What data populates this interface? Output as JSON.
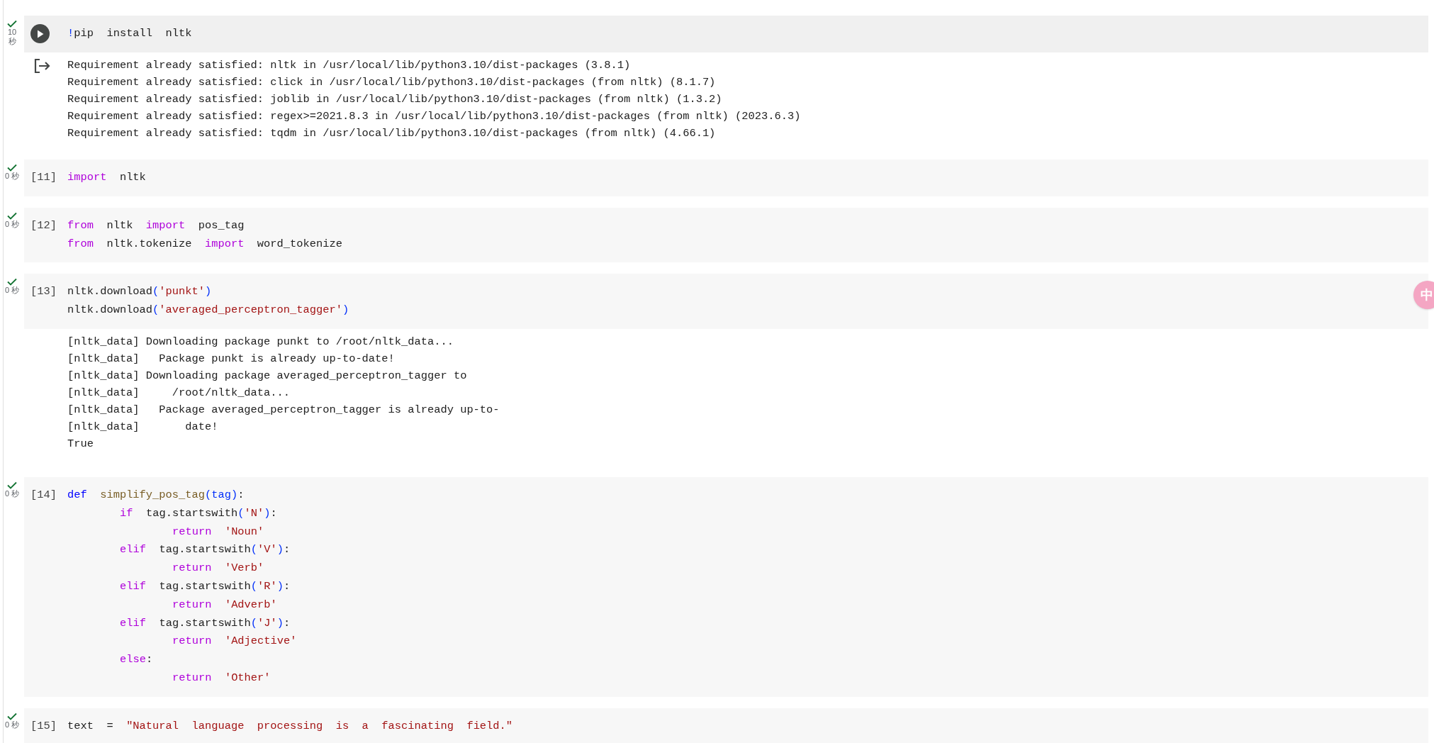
{
  "cells": [
    {
      "focused": true,
      "succeeded": true,
      "duration": "10 秒",
      "lines": [
        {
          "tokens": [
            {
              "kind": "paren",
              "text": "!"
            },
            {
              "kind": "plain",
              "text": "pip  install  nltk"
            }
          ]
        }
      ],
      "output": [
        "Requirement already satisfied: nltk in /usr/local/lib/python3.10/dist-packages (3.8.1)",
        "Requirement already satisfied: click in /usr/local/lib/python3.10/dist-packages (from nltk) (8.1.7)",
        "Requirement already satisfied: joblib in /usr/local/lib/python3.10/dist-packages (from nltk) (1.3.2)",
        "Requirement already satisfied: regex>=2021.8.3 in /usr/local/lib/python3.10/dist-packages (from nltk) (2023.6.3)",
        "Requirement already satisfied: tqdm in /usr/local/lib/python3.10/dist-packages (from nltk) (4.66.1)"
      ]
    },
    {
      "focused": false,
      "succeeded": true,
      "count": "[11]",
      "duration": "0 秒",
      "lines": [
        {
          "tokens": [
            {
              "kind": "keyword",
              "text": "import  "
            },
            {
              "kind": "plain",
              "text": "nltk"
            }
          ]
        }
      ]
    },
    {
      "focused": false,
      "succeeded": true,
      "count": "[12]",
      "duration": "0 秒",
      "lines": [
        {
          "tokens": [
            {
              "kind": "keyword",
              "text": "from  "
            },
            {
              "kind": "plain",
              "text": "nltk  "
            },
            {
              "kind": "keyword",
              "text": "import  "
            },
            {
              "kind": "plain",
              "text": "pos_tag"
            }
          ]
        },
        {
          "tokens": [
            {
              "kind": "keyword",
              "text": "from  "
            },
            {
              "kind": "plain",
              "text": "nltk.tokenize  "
            },
            {
              "kind": "keyword",
              "text": "import  "
            },
            {
              "kind": "plain",
              "text": "word_tokenize"
            }
          ]
        }
      ]
    },
    {
      "focused": false,
      "succeeded": true,
      "count": "[13]",
      "duration": "0 秒",
      "lines": [
        {
          "tokens": [
            {
              "kind": "plain",
              "text": "nltk.download"
            },
            {
              "kind": "paren",
              "text": "("
            },
            {
              "kind": "string",
              "text": "'punkt'"
            },
            {
              "kind": "paren",
              "text": ")"
            }
          ]
        },
        {
          "tokens": [
            {
              "kind": "plain",
              "text": "nltk.download"
            },
            {
              "kind": "paren",
              "text": "("
            },
            {
              "kind": "string",
              "text": "'averaged_perceptron_tagger'"
            },
            {
              "kind": "paren",
              "text": ")"
            }
          ]
        }
      ],
      "output": [
        "[nltk_data] Downloading package punkt to /root/nltk_data...",
        "[nltk_data]   Package punkt is already up-to-date!",
        "[nltk_data] Downloading package averaged_perceptron_tagger to",
        "[nltk_data]     /root/nltk_data...",
        "[nltk_data]   Package averaged_perceptron_tagger is already up-to-",
        "[nltk_data]       date!",
        "True"
      ]
    },
    {
      "focused": false,
      "succeeded": true,
      "count": "[14]",
      "duration": "0 秒",
      "lines": [
        {
          "tokens": [
            {
              "kind": "def",
              "text": "def  "
            },
            {
              "kind": "function",
              "text": "simplify_pos_tag"
            },
            {
              "kind": "paren",
              "text": "(tag)"
            },
            {
              "kind": "plain",
              "text": ":"
            }
          ],
          "children": [
            {
              "tokens": [
                {
                  "kind": "keyword",
                  "text": "if  "
                },
                {
                  "kind": "plain",
                  "text": "tag.startswith"
                },
                {
                  "kind": "paren",
                  "text": "("
                },
                {
                  "kind": "string",
                  "text": "'N'"
                },
                {
                  "kind": "paren",
                  "text": ")"
                },
                {
                  "kind": "plain",
                  "text": ":"
                }
              ],
              "children": [
                {
                  "tokens": [
                    {
                      "kind": "keyword",
                      "text": "return  "
                    },
                    {
                      "kind": "string",
                      "text": "'Noun'"
                    }
                  ]
                }
              ]
            },
            {
              "tokens": [
                {
                  "kind": "keyword",
                  "text": "elif  "
                },
                {
                  "kind": "plain",
                  "text": "tag.startswith"
                },
                {
                  "kind": "paren",
                  "text": "("
                },
                {
                  "kind": "string",
                  "text": "'V'"
                },
                {
                  "kind": "paren",
                  "text": ")"
                },
                {
                  "kind": "plain",
                  "text": ":"
                }
              ],
              "children": [
                {
                  "tokens": [
                    {
                      "kind": "keyword",
                      "text": "return  "
                    },
                    {
                      "kind": "string",
                      "text": "'Verb'"
                    }
                  ]
                }
              ]
            },
            {
              "tokens": [
                {
                  "kind": "keyword",
                  "text": "elif  "
                },
                {
                  "kind": "plain",
                  "text": "tag.startswith"
                },
                {
                  "kind": "paren",
                  "text": "("
                },
                {
                  "kind": "string",
                  "text": "'R'"
                },
                {
                  "kind": "paren",
                  "text": ")"
                },
                {
                  "kind": "plain",
                  "text": ":"
                }
              ],
              "children": [
                {
                  "tokens": [
                    {
                      "kind": "keyword",
                      "text": "return  "
                    },
                    {
                      "kind": "string",
                      "text": "'Adverb'"
                    }
                  ]
                }
              ]
            },
            {
              "tokens": [
                {
                  "kind": "keyword",
                  "text": "elif  "
                },
                {
                  "kind": "plain",
                  "text": "tag.startswith"
                },
                {
                  "kind": "paren",
                  "text": "("
                },
                {
                  "kind": "string",
                  "text": "'J'"
                },
                {
                  "kind": "paren",
                  "text": ")"
                },
                {
                  "kind": "plain",
                  "text": ":"
                }
              ],
              "children": [
                {
                  "tokens": [
                    {
                      "kind": "keyword",
                      "text": "return  "
                    },
                    {
                      "kind": "string",
                      "text": "'Adjective'"
                    }
                  ]
                }
              ]
            },
            {
              "tokens": [
                {
                  "kind": "keyword",
                  "text": "else"
                },
                {
                  "kind": "plain",
                  "text": ":"
                }
              ],
              "children": [
                {
                  "tokens": [
                    {
                      "kind": "keyword",
                      "text": "return  "
                    },
                    {
                      "kind": "string",
                      "text": "'Other'"
                    }
                  ]
                }
              ]
            }
          ]
        }
      ]
    },
    {
      "focused": false,
      "succeeded": true,
      "count": "[15]",
      "duration": "0 秒",
      "lines": [
        {
          "tokens": [
            {
              "kind": "plain",
              "text": "text  =  "
            },
            {
              "kind": "string",
              "text": "\"Natural  language  processing  is  a  fascinating  field.\""
            }
          ]
        }
      ]
    }
  ],
  "ime_badge": "中"
}
